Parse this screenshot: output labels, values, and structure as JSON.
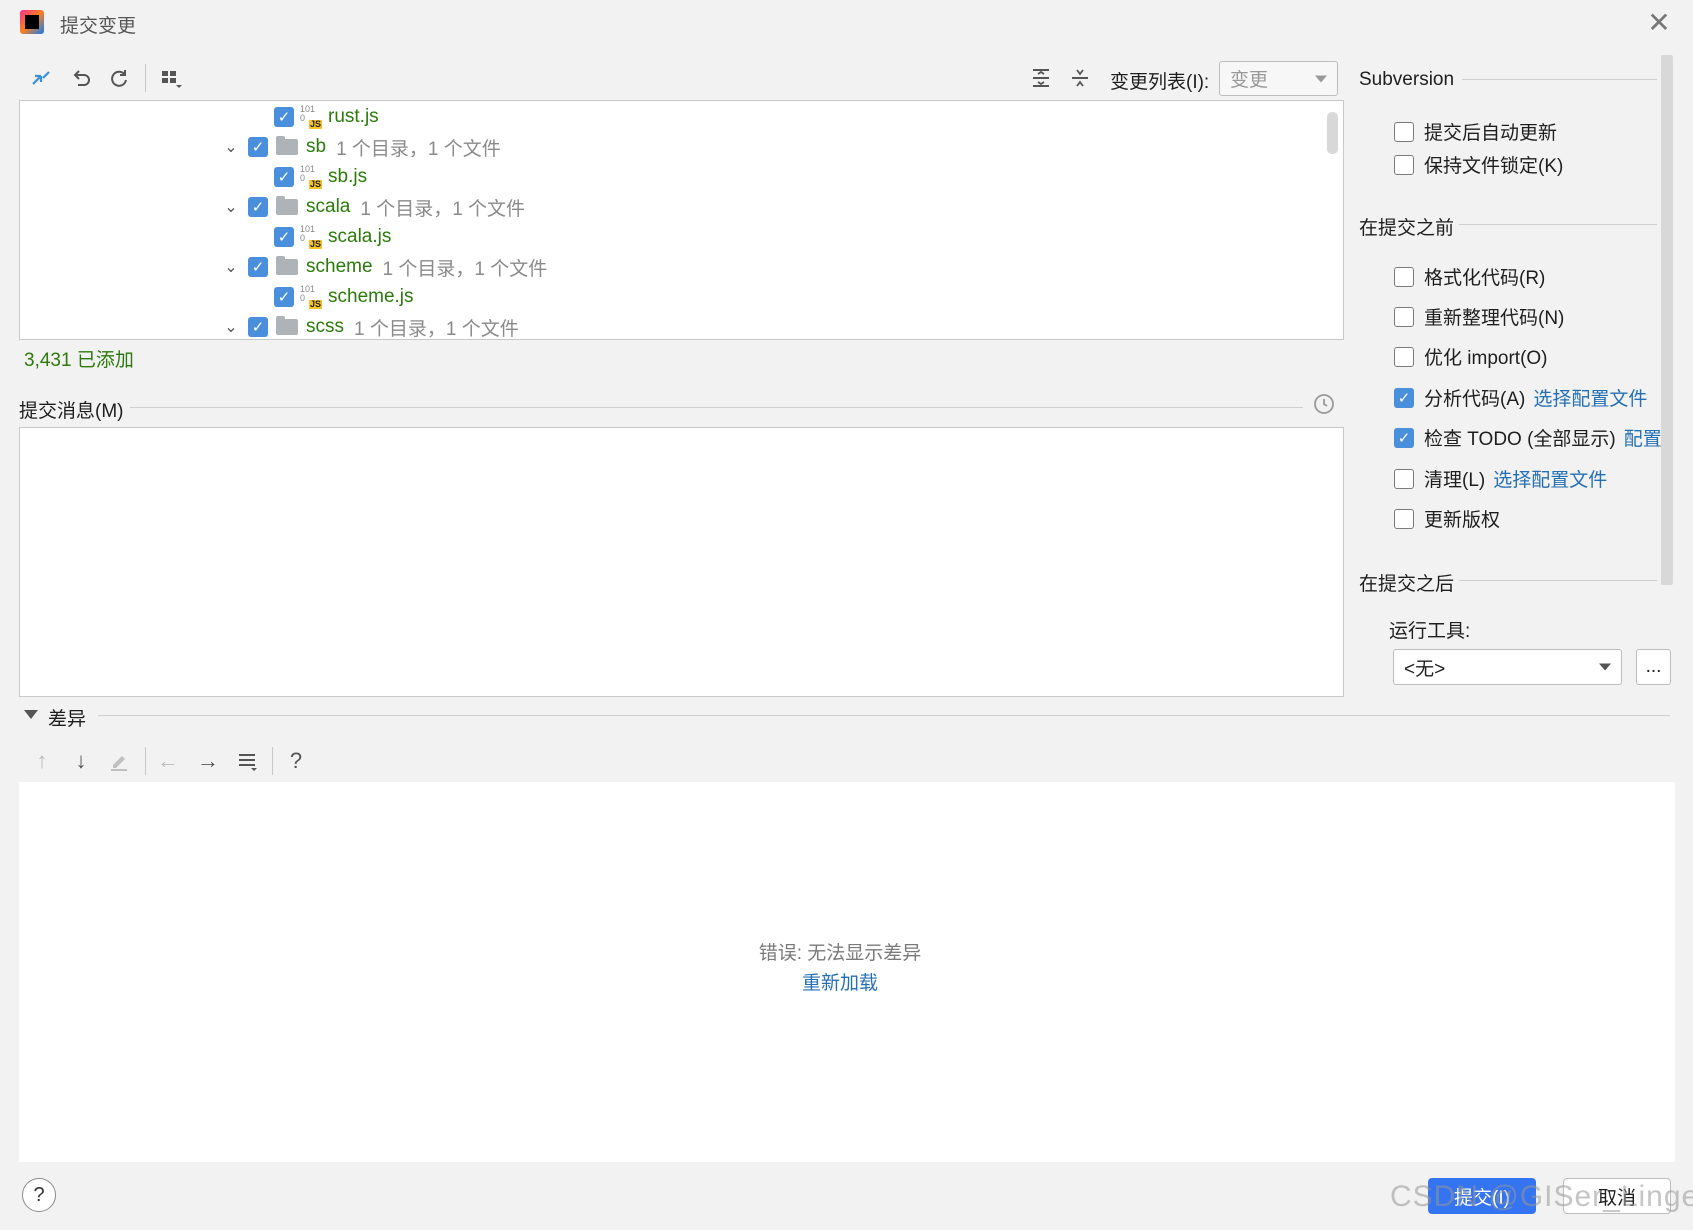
{
  "window": {
    "title": "提交变更",
    "close": "✕"
  },
  "toolbar": {
    "changelist_label": "变更列表(I):",
    "changelist_value": "变更"
  },
  "tree": {
    "rows": [
      {
        "kind": "file",
        "name": "rust.js"
      },
      {
        "kind": "dir",
        "name": "sb",
        "info": "1 个目录，1 个文件"
      },
      {
        "kind": "file",
        "name": "sb.js"
      },
      {
        "kind": "dir",
        "name": "scala",
        "info": "1 个目录，1 个文件"
      },
      {
        "kind": "file",
        "name": "scala.js"
      },
      {
        "kind": "dir",
        "name": "scheme",
        "info": "1 个目录，1 个文件"
      },
      {
        "kind": "file",
        "name": "scheme.js"
      },
      {
        "kind": "dir",
        "name": "scss",
        "info": "1 个目录，1 个文件"
      }
    ],
    "file_icon_digits": "101\n0",
    "file_icon_badge": "JS"
  },
  "status": {
    "added": "3,431 已添加"
  },
  "commit_message": {
    "label": "提交消息(M)"
  },
  "diff": {
    "label": "差异",
    "error": "错误: 无法显示差异",
    "reload": "重新加载",
    "help": "?"
  },
  "options": {
    "subversion_title": "Subversion",
    "auto_update": "提交后自动更新",
    "keep_locks": "保持文件锁定(K)",
    "before_title": "在提交之前",
    "reformat": "格式化代码(R)",
    "rearrange": "重新整理代码(N)",
    "optimize": "优化 import(O)",
    "analyze": "分析代码(A)",
    "analyze_link": "选择配置文件",
    "todo": "检查 TODO (全部显示)",
    "todo_link": "配置",
    "cleanup": "清理(L)",
    "cleanup_link": "选择配置文件",
    "copyright": "更新版权",
    "after_title": "在提交之后",
    "run_tool_label": "运行工具:",
    "run_tool_value": "<无>",
    "more": "..."
  },
  "footer": {
    "help": "?",
    "commit": "提交(I)",
    "cancel": "取消",
    "watermark": "CSDN @GISer_Linger"
  }
}
